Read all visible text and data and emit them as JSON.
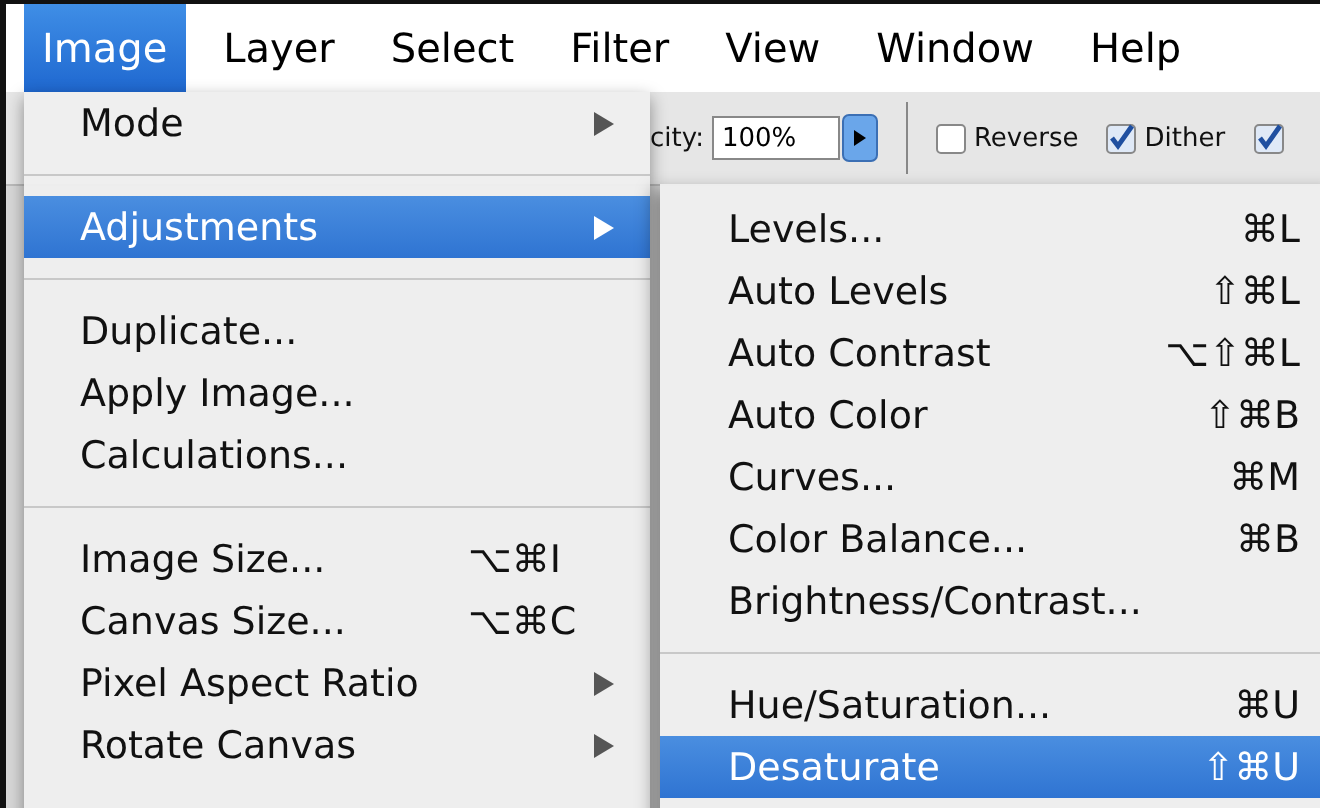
{
  "menu_bar": [
    {
      "label": "Image",
      "selected": true
    },
    {
      "label": "Layer",
      "selected": false
    },
    {
      "label": "Select",
      "selected": false
    },
    {
      "label": "Filter",
      "selected": false
    },
    {
      "label": "View",
      "selected": false
    },
    {
      "label": "Window",
      "selected": false
    },
    {
      "label": "Help",
      "selected": false
    }
  ],
  "toolbar": {
    "opacity_label": "city:",
    "opacity_value": "100%",
    "checkboxes": [
      {
        "label": "Reverse",
        "checked": false
      },
      {
        "label": "Dither",
        "checked": true
      },
      {
        "checked": true
      }
    ]
  },
  "image_menu": [
    {
      "kind": "item",
      "label": "Mode",
      "submenu": true,
      "selected": false,
      "disabled": false
    },
    {
      "kind": "separator"
    },
    {
      "kind": "item",
      "label": "Adjustments",
      "submenu": true,
      "selected": true,
      "disabled": false
    },
    {
      "kind": "separator"
    },
    {
      "kind": "item",
      "label": "Duplicate...",
      "selected": false,
      "disabled": false
    },
    {
      "kind": "item",
      "label": "Apply Image...",
      "selected": false,
      "disabled": false
    },
    {
      "kind": "item",
      "label": "Calculations...",
      "selected": false,
      "disabled": false
    },
    {
      "kind": "separator"
    },
    {
      "kind": "item",
      "label": "Image Size...",
      "shortcut": "⌥⌘I",
      "selected": false,
      "disabled": false
    },
    {
      "kind": "item",
      "label": "Canvas Size...",
      "shortcut": "⌥⌘C",
      "selected": false,
      "disabled": false
    },
    {
      "kind": "item",
      "label": "Pixel Aspect Ratio",
      "submenu": true,
      "selected": false,
      "disabled": false
    },
    {
      "kind": "item",
      "label": "Rotate Canvas",
      "submenu": true,
      "selected": false,
      "disabled": false
    }
  ],
  "adjustments_submenu": [
    {
      "kind": "item",
      "label": "Levels...",
      "shortcut": "⌘L",
      "selected": false
    },
    {
      "kind": "item",
      "label": "Auto Levels",
      "shortcut": "⇧⌘L",
      "selected": false
    },
    {
      "kind": "item",
      "label": "Auto Contrast",
      "shortcut": "⌥⇧⌘L",
      "selected": false
    },
    {
      "kind": "item",
      "label": "Auto Color",
      "shortcut": "⇧⌘B",
      "selected": false
    },
    {
      "kind": "item",
      "label": "Curves...",
      "shortcut": "⌘M",
      "selected": false
    },
    {
      "kind": "item",
      "label": "Color Balance...",
      "shortcut": "⌘B",
      "selected": false
    },
    {
      "kind": "item",
      "label": "Brightness/Contrast...",
      "selected": false
    },
    {
      "kind": "separator"
    },
    {
      "kind": "item",
      "label": "Hue/Saturation...",
      "shortcut": "⌘U",
      "selected": false
    },
    {
      "kind": "item",
      "label": "Desaturate",
      "shortcut": "⇧⌘U",
      "selected": true
    }
  ]
}
